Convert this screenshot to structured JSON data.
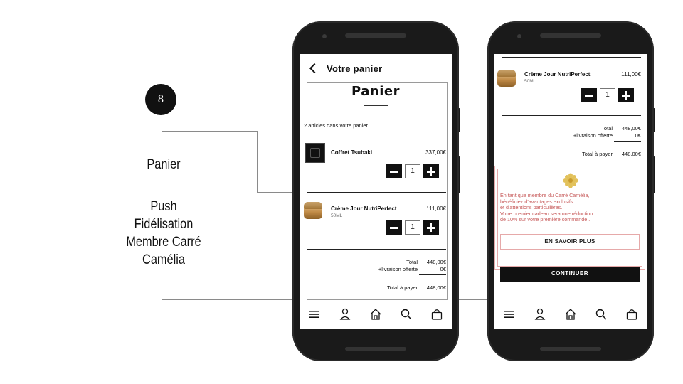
{
  "annotation": {
    "step_number": "8",
    "label_panier": "Panier",
    "label_push_lines": [
      "Push",
      "Fidélisation",
      "Membre Carré",
      "Camélia"
    ]
  },
  "phone_left": {
    "header": {
      "title": "Votre panier"
    },
    "page_title": "Panier",
    "article_count": "2 articles dans votre panier",
    "items": [
      {
        "name": "Coffret Tsubaki",
        "size": "",
        "price": "337,00€",
        "quantity": "1"
      },
      {
        "name": "Crème Jour NutriPerfect",
        "size": "50ML",
        "price": "111,00€",
        "quantity": "1"
      }
    ],
    "totals": {
      "total_label": "Total",
      "total_value": "448,00€",
      "shipping_label": "+livraison offerte",
      "shipping_value": "0€",
      "pay_label": "Total à payer",
      "pay_value": "448,00€"
    }
  },
  "phone_right": {
    "item": {
      "name": "Crème Jour NutriPerfect",
      "size": "50ML",
      "price": "111,00€",
      "quantity": "1"
    },
    "totals": {
      "total_label": "Total",
      "total_value": "448,00€",
      "shipping_label": "+livraison offerte",
      "shipping_value": "0€",
      "pay_label": "Total à payer",
      "pay_value": "448,00€"
    },
    "promo": {
      "lines": [
        "En tant que membre du Carré Camélia,",
        "bénéficiez d'avantages exclusifs",
        "et d'attentions particulières.",
        "Votre premier cadeau sera une réduction",
        "de 10% sur votre première commande ."
      ],
      "button_label": "EN SAVOIR PLUS",
      "accent_color": "#c75a5a",
      "icon": "camelia-flower-icon"
    },
    "continue_label": "CONTINUER"
  },
  "nav_icons": [
    "menu-icon",
    "account-icon",
    "home-icon",
    "search-icon",
    "bag-icon"
  ],
  "colors": {
    "phone_body": "#1a1a1a",
    "primary": "#111111",
    "promo_border": "#e6a9a9"
  }
}
